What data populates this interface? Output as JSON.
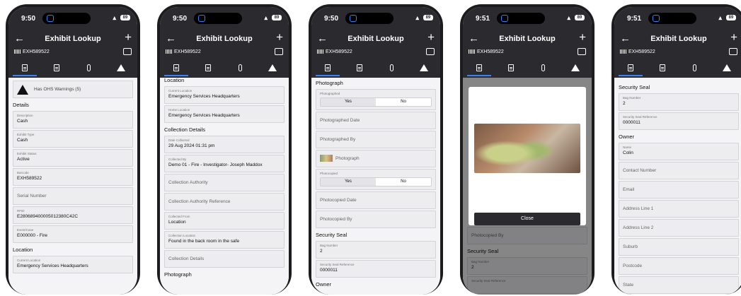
{
  "common": {
    "title": "Exhibit Lookup",
    "exhibit_id": "EXH589522",
    "back_glyph": "←",
    "plus_glyph": "+",
    "battery": "89"
  },
  "phones": [
    {
      "time": "9:50",
      "sections": {
        "warnings": "Has OHS Warnings (5)",
        "details": "Details",
        "description_label": "Description",
        "description": "Cash",
        "type_label": "Exhibit Type",
        "type": "Cash",
        "status_label": "Exhibit Status",
        "status": "Active",
        "barcode_label": "Barcode",
        "barcode": "EXH589522",
        "serial": "Serial Number",
        "rfid_label": "RFID",
        "rfid": "E280689400005012380C42C",
        "event_label": "Event/Case",
        "event": "E000000 - Fire",
        "location": "Location",
        "current_location_label": "Current Location",
        "current_location": "Emergency Services Headquarters"
      }
    },
    {
      "time": "9:50",
      "sections": {
        "location": "Location",
        "current_location_label": "Current Location",
        "current_location": "Emergency Services Headquarters",
        "home_location_label": "Home Location",
        "home_location": "Emergency Services Headquarters",
        "collection_details": "Collection Details",
        "date_collected_label": "Date Collected",
        "date_collected": "29 Aug 2024 01:31 pm",
        "collected_by_label": "Collected By",
        "collected_by": "Demo 01 - Fire - Investigator- Joseph Maddox",
        "collection_authority": "Collection Authority",
        "collection_authority_ref": "Collection Authority Reference",
        "collected_from_label": "Collected From",
        "collected_from": "Location",
        "collection_location_label": "Collection Location",
        "collection_location": "Found in the back room in the safe",
        "collection_details_field": "Collection Details",
        "photograph": "Photograph"
      }
    },
    {
      "time": "9:50",
      "sections": {
        "photograph": "Photograph",
        "photographed_label": "Photographed",
        "yes": "Yes",
        "no": "No",
        "photographed_date": "Photographed Date",
        "photographed_by": "Photographed By",
        "photograph_item": "Photograph",
        "photocopied_label": "Photocopied",
        "photocopied_date": "Photocopied Date",
        "photocopied_by": "Photocopied By",
        "security_seal": "Security Seal",
        "bag_number_label": "Bag Number",
        "bag_number": "2",
        "seal_ref_label": "Security Seal Reference",
        "seal_ref": "0000011",
        "owner": "Owner"
      }
    },
    {
      "time": "9:51",
      "sections": {
        "photocopied_by": "Photocopied By",
        "security_seal": "Security Seal",
        "bag_number_label": "Bag Number",
        "bag_number": "2",
        "seal_ref_label": "Security Seal Reference",
        "close": "Close"
      }
    },
    {
      "time": "9:51",
      "sections": {
        "security_seal": "Security Seal",
        "bag_number_label": "Bag Number",
        "bag_number": "2",
        "seal_ref_label": "Security Seal Reference",
        "seal_ref": "0000011",
        "owner": "Owner",
        "name_label": "Name",
        "name": "Colin",
        "contact": "Contact Number",
        "email": "Email",
        "addr1": "Address Line 1",
        "addr2": "Address Line 2",
        "suburb": "Suburb",
        "postcode": "Postcode",
        "state": "State"
      }
    }
  ]
}
